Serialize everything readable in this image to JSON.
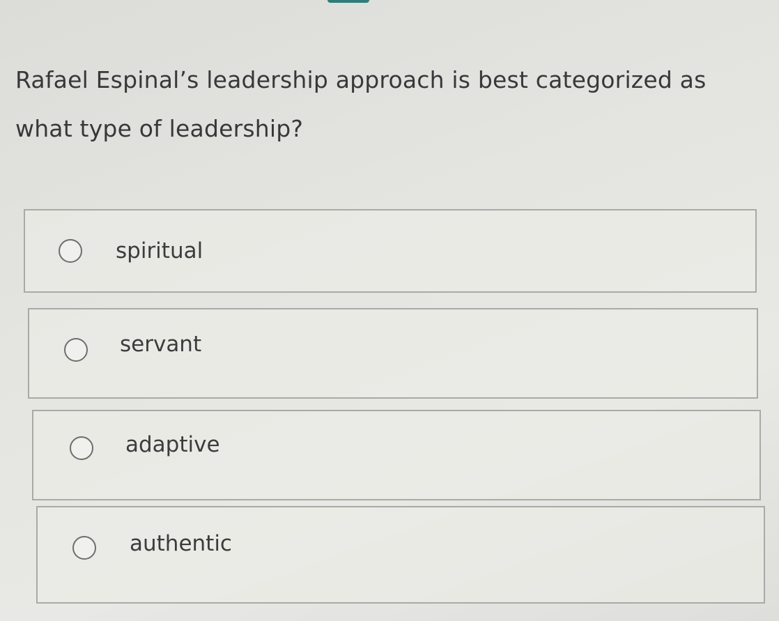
{
  "question": {
    "text": "Rafael Espinal’s leadership approach is best categorized as what type of leadership?"
  },
  "options": [
    {
      "label": "spiritual",
      "selected": false
    },
    {
      "label": "servant",
      "selected": false
    },
    {
      "label": "adaptive",
      "selected": false
    },
    {
      "label": "authentic",
      "selected": false
    }
  ],
  "colors": {
    "accent": "#2f7d7a",
    "border": "#a9a9a7",
    "text": "#38383a"
  }
}
